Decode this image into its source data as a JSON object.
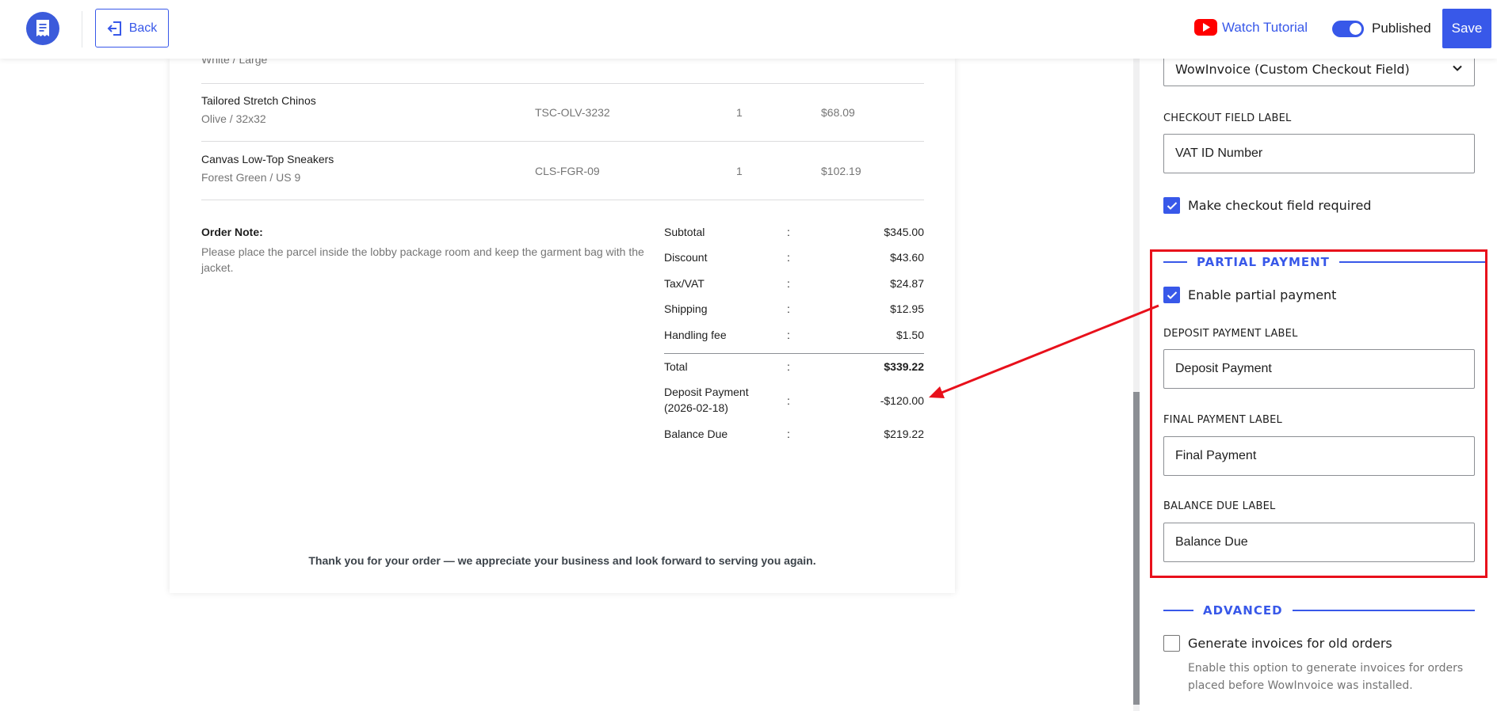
{
  "header": {
    "back_label": "Back",
    "tutorial_label": "Watch Tutorial",
    "published_label": "Published",
    "published_on": true,
    "save_label": "Save"
  },
  "invoice": {
    "cut_item_variant": "White / Large",
    "items": [
      {
        "name": "Tailored Stretch Chinos",
        "variant": "Olive / 32x32",
        "sku": "TSC-OLV-3232",
        "qty": "1",
        "price": "$68.09"
      },
      {
        "name": "Canvas Low-Top Sneakers",
        "variant": "Forest Green / US 9",
        "sku": "CLS-FGR-09",
        "qty": "1",
        "price": "$102.19"
      }
    ],
    "note_label": "Order Note:",
    "note_text": "Please place the parcel inside the lobby package room and keep the garment bag with the jacket.",
    "summary": {
      "subtotal": {
        "label": "Subtotal",
        "value": "$345.00"
      },
      "discount": {
        "label": "Discount",
        "value": "$43.60"
      },
      "tax": {
        "label": "Tax/VAT",
        "value": "$24.87"
      },
      "shipping": {
        "label": "Shipping",
        "value": "$12.95"
      },
      "handling": {
        "label": "Handling fee",
        "value": "$1.50"
      },
      "total": {
        "label": "Total",
        "value": "$339.22"
      },
      "deposit": {
        "label": "Deposit Payment",
        "date": "(2026-02-18)",
        "value": "-$120.00"
      },
      "balance": {
        "label": "Balance Due",
        "value": "$219.22"
      }
    },
    "colon": ":",
    "thanks": "Thank you for your order — we appreciate your business and look forward to serving you again."
  },
  "settings": {
    "checkout_source_value": "WowInvoice (Custom Checkout Field)",
    "checkout_field_label_title": "CHECKOUT FIELD LABEL",
    "checkout_field_label_value": "VAT ID Number",
    "make_required_label": "Make checkout field required",
    "make_required_checked": true,
    "partial_payment": {
      "title": "PARTIAL PAYMENT",
      "enable_label": "Enable partial payment",
      "enable_checked": true,
      "deposit_label_title": "DEPOSIT PAYMENT LABEL",
      "deposit_label_value": "Deposit Payment",
      "final_label_title": "FINAL PAYMENT LABEL",
      "final_label_value": "Final Payment",
      "balance_label_title": "BALANCE DUE LABEL",
      "balance_label_value": "Balance Due"
    },
    "advanced": {
      "title": "ADVANCED",
      "old_orders_label": "Generate invoices for old orders",
      "old_orders_checked": false,
      "old_orders_help": "Enable this option to generate invoices for orders placed before WowInvoice was installed."
    }
  },
  "colors": {
    "accent": "#3858e9",
    "annotation": "#e8101b",
    "youtube": "#ff0000"
  },
  "icons": {
    "logo": "invoice-receipt-icon",
    "back": "exit-arrow-icon",
    "tutorial": "youtube-icon",
    "select": "chevron-down-icon",
    "checkbox": "checkmark-icon"
  }
}
